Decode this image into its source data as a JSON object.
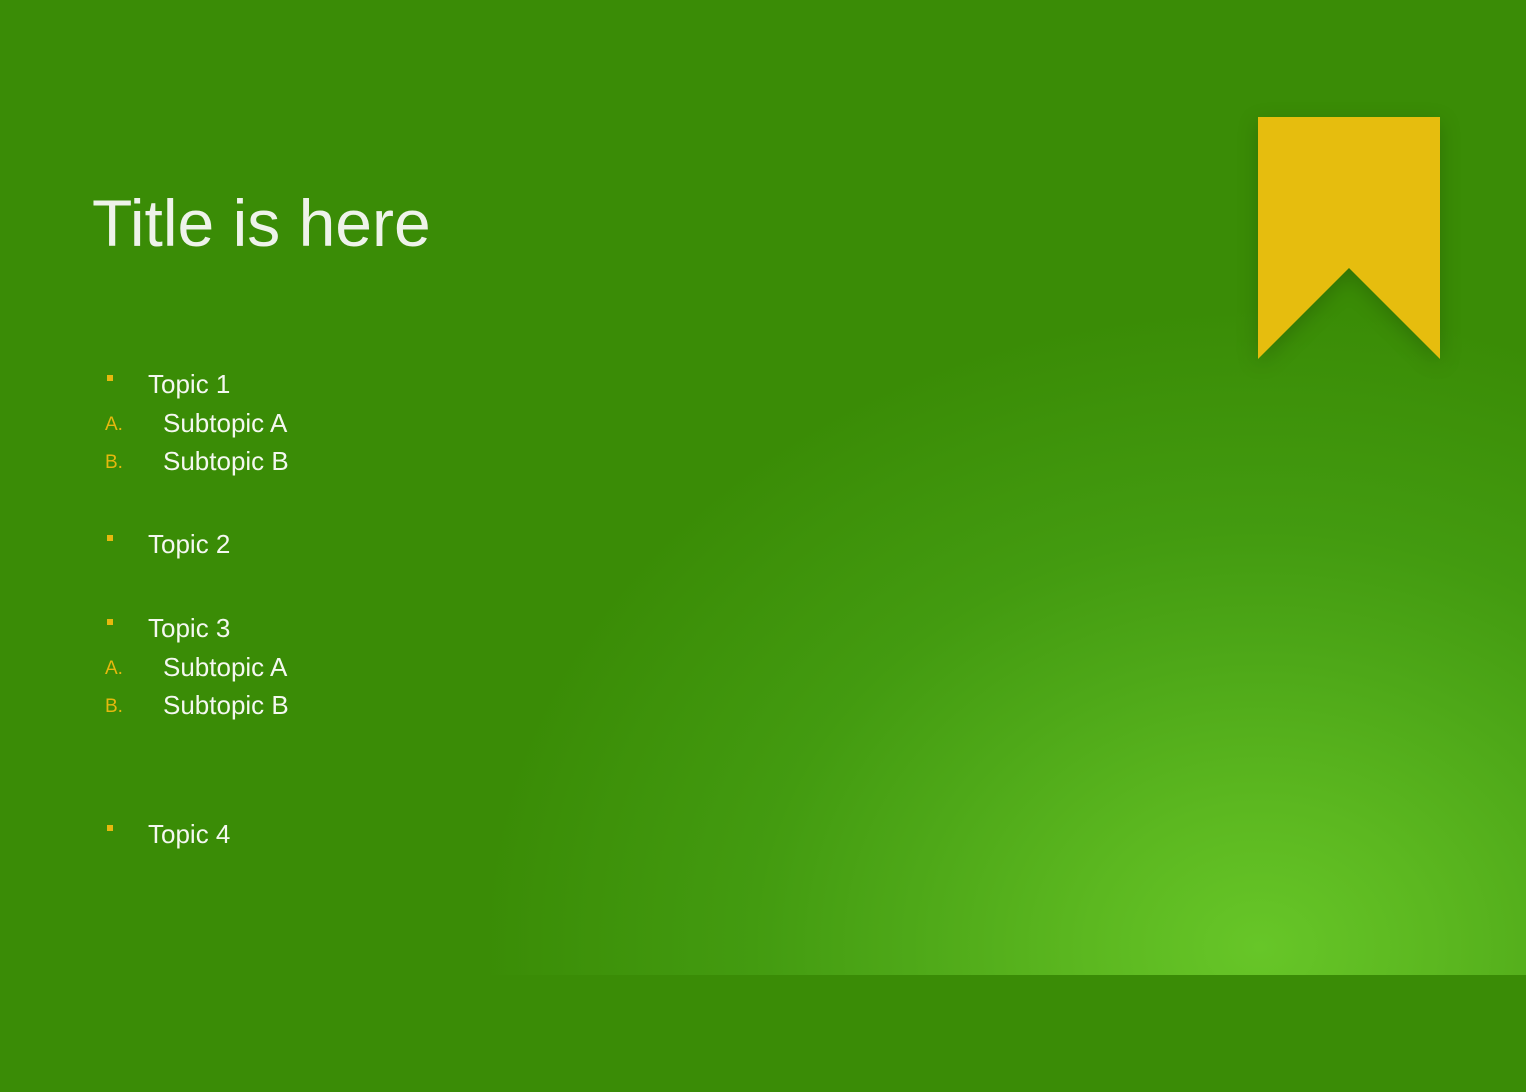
{
  "slide": {
    "title": "Title is here",
    "topics": [
      {
        "label": "Topic 1",
        "subtopics": [
          {
            "marker": "A.",
            "label": "Subtopic A"
          },
          {
            "marker": "B.",
            "label": "Subtopic B"
          }
        ]
      },
      {
        "label": "Topic 2",
        "subtopics": []
      },
      {
        "label": "Topic 3",
        "subtopics": [
          {
            "marker": "A.",
            "label": "Subtopic A"
          },
          {
            "marker": "B.",
            "label": "Subtopic B"
          }
        ]
      },
      {
        "label": "Topic 4",
        "subtopics": []
      }
    ]
  },
  "colors": {
    "background": "#3a8c06",
    "glow": "#67c628",
    "accent": "#e6b80e",
    "text": "#f4f8f0"
  },
  "icons": {
    "bookmark": "bookmark-icon",
    "bullet": "square-bullet-icon"
  }
}
